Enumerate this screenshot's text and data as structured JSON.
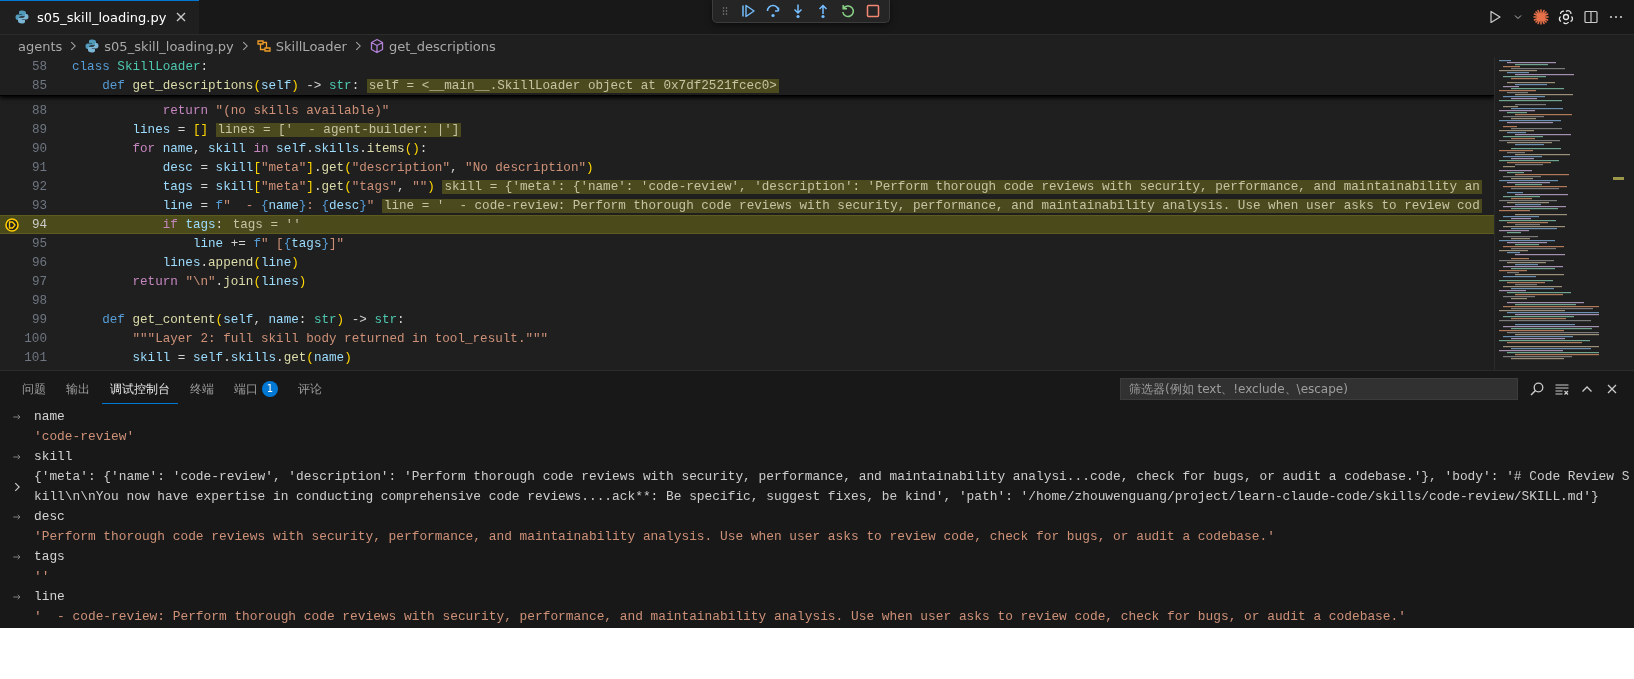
{
  "editor_tab": {
    "label": "s05_skill_loading.py",
    "selected": true
  },
  "breadcrumbs": [
    {
      "label": "agents",
      "kind": "folder"
    },
    {
      "label": "s05_skill_loading.py",
      "kind": "file"
    },
    {
      "label": "SkillLoader",
      "kind": "class"
    },
    {
      "label": "get_descriptions",
      "kind": "method"
    }
  ],
  "sticky_lines": [
    {
      "number": "58",
      "tokens": [
        {
          "text": "class ",
          "kind": "kw"
        },
        {
          "text": "SkillLoader",
          "kind": "cls"
        },
        {
          "text": ":",
          "kind": "p"
        }
      ]
    },
    {
      "number": "85",
      "tokens": [
        {
          "text": "    def ",
          "kind": "kw"
        },
        {
          "text": "get_descriptions",
          "kind": "fn"
        },
        {
          "text": "(",
          "kind": "b1"
        },
        {
          "text": "self",
          "kind": "var"
        },
        {
          "text": ")",
          "kind": "b1"
        },
        {
          "text": " -> ",
          "kind": "p"
        },
        {
          "text": "str",
          "kind": "cls"
        },
        {
          "text": ":",
          "kind": "p"
        }
      ],
      "hint": "self = <__main__.SkillLoader object at 0x7df2521fcec0>"
    }
  ],
  "lines": [
    {
      "number": "88",
      "current": false,
      "stopped": false,
      "tokens": [
        {
          "text": "            return ",
          "kind": "ctl"
        },
        {
          "text": "\"(no skills available)\"",
          "kind": "str"
        }
      ]
    },
    {
      "number": "89",
      "current": false,
      "stopped": false,
      "tokens": [
        {
          "text": "        lines",
          "kind": "var"
        },
        {
          "text": " = ",
          "kind": "p"
        },
        {
          "text": "[]",
          "kind": "b1"
        }
      ],
      "hint": "lines = ['  - agent-builder: |']"
    },
    {
      "number": "90",
      "current": false,
      "stopped": false,
      "tokens": [
        {
          "text": "        for ",
          "kind": "ctl"
        },
        {
          "text": "name",
          "kind": "var"
        },
        {
          "text": ", ",
          "kind": "p"
        },
        {
          "text": "skill ",
          "kind": "var"
        },
        {
          "text": "in ",
          "kind": "ctl"
        },
        {
          "text": "self",
          "kind": "var"
        },
        {
          "text": ".",
          "kind": "p"
        },
        {
          "text": "skills",
          "kind": "var"
        },
        {
          "text": ".",
          "kind": "p"
        },
        {
          "text": "items",
          "kind": "fn"
        },
        {
          "text": "()",
          "kind": "b1"
        },
        {
          "text": ":",
          "kind": "p"
        }
      ]
    },
    {
      "number": "91",
      "current": false,
      "stopped": false,
      "tokens": [
        {
          "text": "            desc",
          "kind": "var"
        },
        {
          "text": " = ",
          "kind": "p"
        },
        {
          "text": "skill",
          "kind": "var"
        },
        {
          "text": "[",
          "kind": "b1"
        },
        {
          "text": "\"meta\"",
          "kind": "str"
        },
        {
          "text": "]",
          "kind": "b1"
        },
        {
          "text": ".",
          "kind": "p"
        },
        {
          "text": "get",
          "kind": "fn"
        },
        {
          "text": "(",
          "kind": "b1"
        },
        {
          "text": "\"description\"",
          "kind": "str"
        },
        {
          "text": ", ",
          "kind": "p"
        },
        {
          "text": "\"No description\"",
          "kind": "str"
        },
        {
          "text": ")",
          "kind": "b1"
        }
      ]
    },
    {
      "number": "92",
      "current": false,
      "stopped": false,
      "tokens": [
        {
          "text": "            tags",
          "kind": "var"
        },
        {
          "text": " = ",
          "kind": "p"
        },
        {
          "text": "skill",
          "kind": "var"
        },
        {
          "text": "[",
          "kind": "b1"
        },
        {
          "text": "\"meta\"",
          "kind": "str"
        },
        {
          "text": "]",
          "kind": "b1"
        },
        {
          "text": ".",
          "kind": "p"
        },
        {
          "text": "get",
          "kind": "fn"
        },
        {
          "text": "(",
          "kind": "b1"
        },
        {
          "text": "\"tags\"",
          "kind": "str"
        },
        {
          "text": ", ",
          "kind": "p"
        },
        {
          "text": "\"\"",
          "kind": "str"
        },
        {
          "text": ")",
          "kind": "b1"
        }
      ],
      "hint": "skill = {'meta': {'name': 'code-review', 'description': 'Perform thorough code reviews with security, performance, and maintainability an"
    },
    {
      "number": "93",
      "current": false,
      "stopped": false,
      "tokens": [
        {
          "text": "            line",
          "kind": "var"
        },
        {
          "text": " = ",
          "kind": "p"
        },
        {
          "text": "f",
          "kind": "kw"
        },
        {
          "text": "\"  - ",
          "kind": "str"
        },
        {
          "text": "{",
          "kind": "fb"
        },
        {
          "text": "name",
          "kind": "var"
        },
        {
          "text": "}",
          "kind": "fb"
        },
        {
          "text": ": ",
          "kind": "str"
        },
        {
          "text": "{",
          "kind": "fb"
        },
        {
          "text": "desc",
          "kind": "var"
        },
        {
          "text": "}",
          "kind": "fb"
        },
        {
          "text": "\"",
          "kind": "str"
        }
      ],
      "hint": "line = '  - code-review: Perform thorough code reviews with security, performance, and maintainability analysis. Use when user asks to review cod"
    },
    {
      "number": "94",
      "current": true,
      "stopped": true,
      "tokens": [
        {
          "text": "            if ",
          "kind": "ctl"
        },
        {
          "text": "tags",
          "kind": "var"
        },
        {
          "text": ":",
          "kind": "p"
        }
      ],
      "hint": "tags = ''"
    },
    {
      "number": "95",
      "current": false,
      "stopped": false,
      "tokens": [
        {
          "text": "                line",
          "kind": "var"
        },
        {
          "text": " += ",
          "kind": "p"
        },
        {
          "text": "f",
          "kind": "kw"
        },
        {
          "text": "\" [",
          "kind": "str"
        },
        {
          "text": "{",
          "kind": "fb"
        },
        {
          "text": "tags",
          "kind": "var"
        },
        {
          "text": "}",
          "kind": "fb"
        },
        {
          "text": "]\"",
          "kind": "str"
        }
      ]
    },
    {
      "number": "96",
      "current": false,
      "stopped": false,
      "tokens": [
        {
          "text": "            lines",
          "kind": "var"
        },
        {
          "text": ".",
          "kind": "p"
        },
        {
          "text": "append",
          "kind": "fn"
        },
        {
          "text": "(",
          "kind": "b1"
        },
        {
          "text": "line",
          "kind": "var"
        },
        {
          "text": ")",
          "kind": "b1"
        }
      ]
    },
    {
      "number": "97",
      "current": false,
      "stopped": false,
      "tokens": [
        {
          "text": "        return ",
          "kind": "ctl"
        },
        {
          "text": "\"\\n\"",
          "kind": "str"
        },
        {
          "text": ".",
          "kind": "p"
        },
        {
          "text": "join",
          "kind": "fn"
        },
        {
          "text": "(",
          "kind": "b1"
        },
        {
          "text": "lines",
          "kind": "var"
        },
        {
          "text": ")",
          "kind": "b1"
        }
      ]
    },
    {
      "number": "98",
      "current": false,
      "stopped": false
    },
    {
      "number": "99",
      "current": false,
      "stopped": false,
      "tokens": [
        {
          "text": "    def ",
          "kind": "kw"
        },
        {
          "text": "get_content",
          "kind": "fn"
        },
        {
          "text": "(",
          "kind": "b1"
        },
        {
          "text": "self",
          "kind": "var"
        },
        {
          "text": ", ",
          "kind": "p"
        },
        {
          "text": "name",
          "kind": "var"
        },
        {
          "text": ": ",
          "kind": "p"
        },
        {
          "text": "str",
          "kind": "cls"
        },
        {
          "text": ")",
          "kind": "b1"
        },
        {
          "text": " -> ",
          "kind": "p"
        },
        {
          "text": "str",
          "kind": "cls"
        },
        {
          "text": ":",
          "kind": "p"
        }
      ]
    },
    {
      "number": "100",
      "current": false,
      "stopped": false,
      "tokens": [
        {
          "text": "        \"\"\"Layer 2: full skill body returned in tool_result.\"\"\"",
          "kind": "str"
        }
      ]
    },
    {
      "number": "101",
      "current": false,
      "stopped": false,
      "tokens": [
        {
          "text": "        skill",
          "kind": "var"
        },
        {
          "text": " = ",
          "kind": "p"
        },
        {
          "text": "self",
          "kind": "var"
        },
        {
          "text": ".",
          "kind": "p"
        },
        {
          "text": "skills",
          "kind": "var"
        },
        {
          "text": ".",
          "kind": "p"
        },
        {
          "text": "get",
          "kind": "fn"
        },
        {
          "text": "(",
          "kind": "b1"
        },
        {
          "text": "name",
          "kind": "var"
        },
        {
          "text": ")",
          "kind": "b1"
        }
      ]
    }
  ],
  "panel": {
    "tabs": [
      {
        "label": "问题",
        "selected": false
      },
      {
        "label": "输出",
        "selected": false
      },
      {
        "label": "调试控制台",
        "selected": true
      },
      {
        "label": "终端",
        "selected": false
      },
      {
        "label": "端口",
        "badge": "1",
        "selected": false
      },
      {
        "label": "评论",
        "selected": false
      }
    ],
    "filter": {
      "placeholder": "筛选器(例如 text、!exclude、\\escape)"
    },
    "console": [
      {
        "expression": "name",
        "value": "'code-review'",
        "kind": "string"
      },
      {
        "expression": "skill",
        "value": "{'meta': {'name': 'code-review', 'description': 'Perform thorough code reviews with security, performance, and maintainability analysi...code, check for bugs, or audit a codebase.'}, 'body': '# Code Review Skill\\n\\nYou now have expertise in conducting comprehensive code reviews....ack**: Be specific, suggest fixes, be kind', 'path': '/home/zhouwenguang/project/learn-claude-code/skills/code-review/SKILL.md'}",
        "kind": "object"
      },
      {
        "expression": "desc",
        "value": "'Perform thorough code reviews with security, performance, and maintainability analysis. Use when user asks to review code, check for bugs, or audit a codebase.'",
        "kind": "string"
      },
      {
        "expression": "tags",
        "value": "''",
        "kind": "string"
      },
      {
        "expression": "line",
        "value": "'  - code-review: Perform thorough code reviews with security, performance, and maintainability analysis. Use when user asks to review code, check for bugs, or audit a codebase.'",
        "kind": "string"
      }
    ]
  }
}
